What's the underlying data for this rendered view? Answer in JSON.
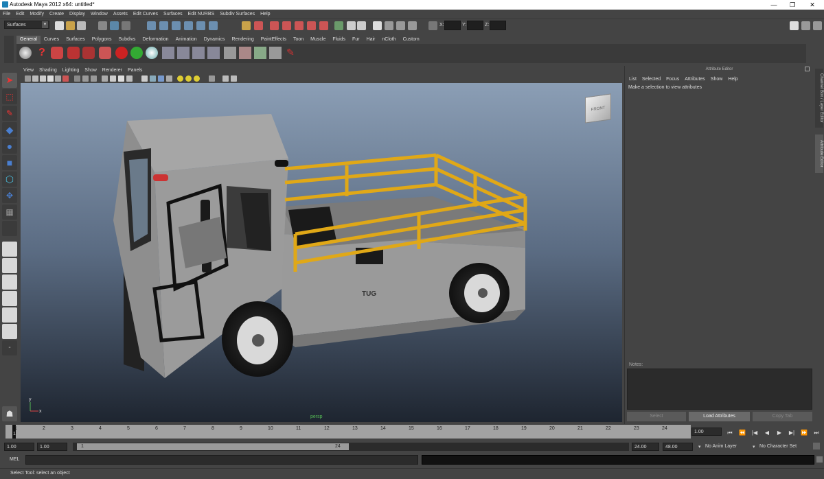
{
  "window": {
    "title": "Autodesk Maya 2012 x64: untitled*",
    "minimize": "—",
    "restore": "❐",
    "close": "✕"
  },
  "menubar": [
    "File",
    "Edit",
    "Modify",
    "Create",
    "Display",
    "Window",
    "Assets",
    "Edit Curves",
    "Surfaces",
    "Edit NURBS",
    "Subdiv Surfaces",
    "Help"
  ],
  "statusline": {
    "menu_set": "Surfaces",
    "x_label": "X:",
    "y_label": "Y:",
    "z_label": "Z:"
  },
  "shelf": {
    "tabs": [
      "General",
      "Curves",
      "Surfaces",
      "Polygons",
      "Subdivs",
      "Deformation",
      "Animation",
      "Dynamics",
      "Rendering",
      "PaintEffects",
      "Toon",
      "Muscle",
      "Fluids",
      "Fur",
      "Hair",
      "nCloth",
      "Custom"
    ],
    "active": "General"
  },
  "viewport": {
    "menu": [
      "View",
      "Shading",
      "Lighting",
      "Show",
      "Renderer",
      "Panels"
    ],
    "viewcube_label": "FRONT",
    "camera_label": "persp",
    "truck_badge": "TUG",
    "axis": {
      "x": "x",
      "y": "y"
    }
  },
  "attribute_editor": {
    "title": "Attribute Editor",
    "menu": [
      "List",
      "Selected",
      "Focus",
      "Attributes",
      "Show",
      "Help"
    ],
    "message": "Make a selection to view attributes",
    "notes_label": "Notes:",
    "buttons": {
      "select": "Select",
      "load": "Load Attributes",
      "copy": "Copy Tab"
    }
  },
  "side_tabs": [
    "Channel Box / Layer Editor",
    "Attribute Editor"
  ],
  "timeline": {
    "ticks": [
      "1",
      "2",
      "3",
      "4",
      "5",
      "6",
      "7",
      "8",
      "9",
      "10",
      "11",
      "12",
      "13",
      "14",
      "15",
      "16",
      "17",
      "18",
      "19",
      "20",
      "21",
      "22",
      "23",
      "24"
    ],
    "current_frame": "1.00",
    "current_marker": "1"
  },
  "playback": [
    "⏮",
    "⏪",
    "|◀",
    "◀",
    "▶",
    "▶|",
    "⏩",
    "⏭"
  ],
  "range": {
    "start": "1.00",
    "anim_start": "1.00",
    "slider_start": "1",
    "slider_end": "24",
    "anim_end": "24.00",
    "end": "48.00",
    "anim_layer": "No Anim Layer",
    "character_set": "No Character Set"
  },
  "command_line": {
    "label": "MEL"
  },
  "help_line": "Select Tool: select an object",
  "colors": {
    "accent": "#5285a6",
    "rail": "#e0a817",
    "body": "#9e9e9e",
    "active_tab": "#5d5d5d"
  }
}
